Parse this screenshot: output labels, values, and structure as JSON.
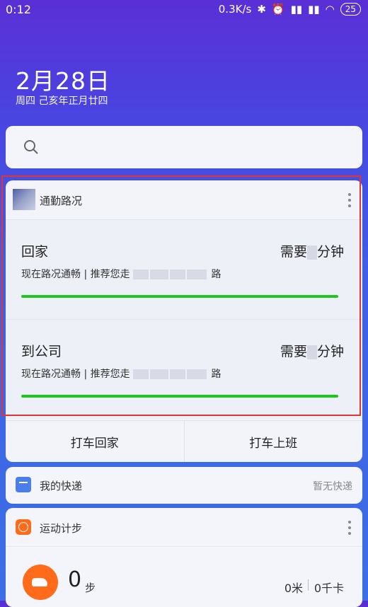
{
  "status_bar": {
    "time": "0:12",
    "speed": "0.3K/s",
    "battery": "25"
  },
  "date": {
    "main": "2月28日",
    "sub": "周四 己亥年正月廿四"
  },
  "search": {
    "placeholder": ""
  },
  "commute": {
    "title": "通勤路况",
    "routes": [
      {
        "destination": "回家",
        "need_prefix": "需要",
        "need_suffix": "分钟",
        "desc_prefix": "现在路况通畅 | 推荐您走",
        "desc_suffix": "路",
        "status_color": "#21c521"
      },
      {
        "destination": "到公司",
        "need_prefix": "需要",
        "need_suffix": "分钟",
        "desc_prefix": "现在路况通畅 | 推荐您走",
        "desc_suffix": "路",
        "status_color": "#21c521"
      }
    ],
    "buttons": {
      "taxi_home": "打车回家",
      "taxi_work": "打车上班"
    }
  },
  "express": {
    "title": "我的快递",
    "status": "暂无快递"
  },
  "steps": {
    "title": "运动计步",
    "count": "0",
    "unit": "步",
    "distance": "0米",
    "calories": "0千卡"
  }
}
